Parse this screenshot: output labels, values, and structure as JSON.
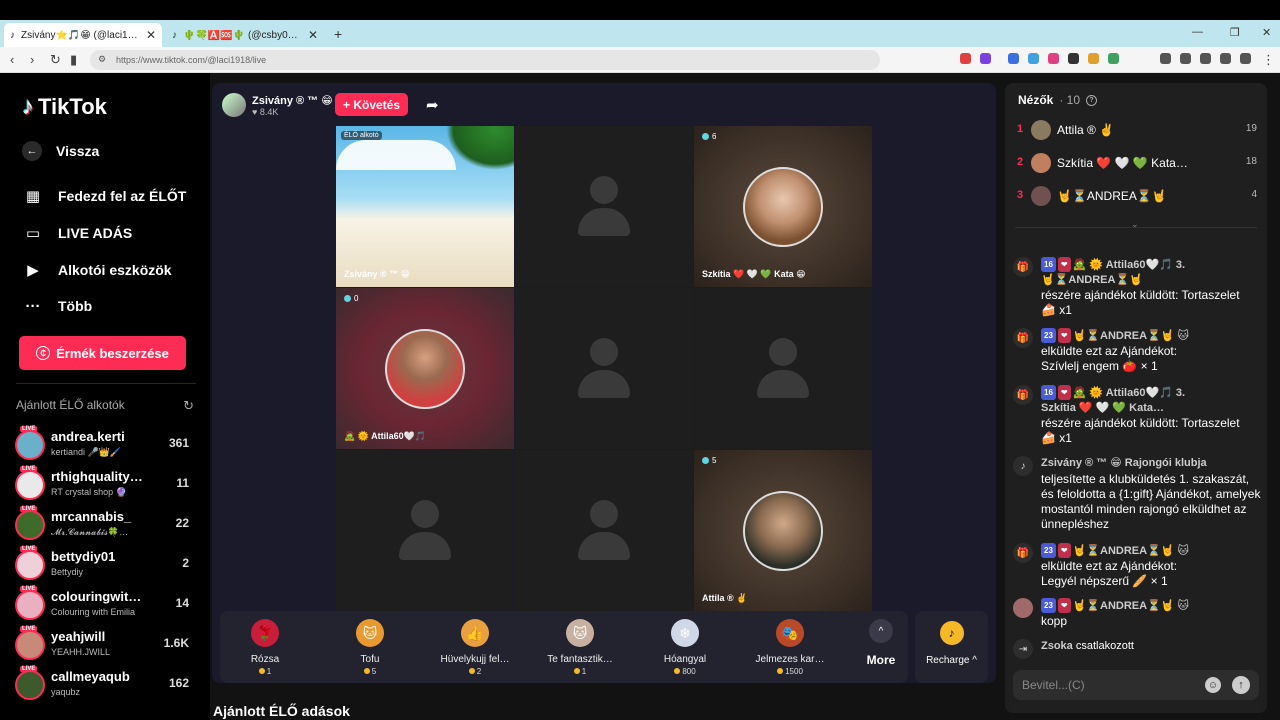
{
  "browser": {
    "tabs": [
      {
        "icon": "tiktok-icon",
        "title": "Zsivány⭐🎵😁 (@laci1918) É…",
        "close": "✕"
      },
      {
        "icon": "tiktok-icon",
        "title": "🌵🍀🅰️🆘🌵 (@csby0…",
        "close": "✕"
      }
    ],
    "new_tab": "+",
    "url": "https://www.tiktok.com/@laci1918/live"
  },
  "sidebar": {
    "logo": "TikTok",
    "nav": [
      {
        "icon": "back-arrow-icon",
        "label": "Vissza"
      },
      {
        "icon": "explore-live-icon",
        "label": "Fedezd fel az ÉLŐT"
      },
      {
        "icon": "video-camera-icon",
        "label": "LIVE ADÁS"
      },
      {
        "icon": "creator-tools-icon",
        "label": "Alkotói eszközök"
      },
      {
        "icon": "more-dots-icon",
        "label": "Több"
      }
    ],
    "coins_button": "Érmék beszerzése",
    "recommended_title": "Ajánlott ÉLŐ alkotók",
    "creators": [
      {
        "name": "andrea.kerti",
        "sub": "kertiandi 🎤👑🖌️",
        "viewers": "361",
        "live": "LIVE",
        "color": "#6bb0c9"
      },
      {
        "name": "rthighquality…",
        "sub": "RT crystal shop 🔮",
        "viewers": "11",
        "live": "LIVE",
        "color": "#e9e9e9"
      },
      {
        "name": "mrcannabis_",
        "sub": "𝓜𝓻.𝓒𝓪𝓷𝓷𝓪𝓫𝓲𝓼🍀…",
        "viewers": "22",
        "live": "LIVE",
        "color": "#3f6b2a"
      },
      {
        "name": "bettydiy01",
        "sub": "Bettydiy",
        "viewers": "2",
        "live": "LIVE",
        "color": "#f0d0d8"
      },
      {
        "name": "colouringwit…",
        "sub": "Colouring with Emilia",
        "viewers": "14",
        "live": "LIVE",
        "color": "#e8b0c0"
      },
      {
        "name": "yeahjwill",
        "sub": "YEAHH.JWILL",
        "viewers": "1.6K",
        "live": "LIVE",
        "color": "#c88a78"
      },
      {
        "name": "callmeyaqub",
        "sub": "yaqubz",
        "viewers": "162",
        "live": "LIVE",
        "color": "#3c5a2c"
      }
    ]
  },
  "stream": {
    "host_name": "Zsivány ® ™ 😁",
    "likes": "♥ 8.4K",
    "follow_button": "+ Követés",
    "cells": [
      {
        "badge": "ÉLŐ alkotó",
        "name": "Zsivány ® ™ 😁"
      },
      {},
      {
        "count": "6",
        "name": "Szkítia ❤️ 🤍 💚 Kata 😁"
      },
      {
        "count": "0",
        "name": "🧟 🌞 Attila60🤍🎵"
      },
      {},
      {},
      {},
      {},
      {
        "count": "5",
        "name": "Attila ® ✌️"
      }
    ],
    "gifts": [
      {
        "name": "Rózsa",
        "price": "1",
        "emoji": "🌹",
        "color": "#c81e3a"
      },
      {
        "name": "Tofu",
        "price": "5",
        "emoji": "🐱",
        "color": "#e89a30"
      },
      {
        "name": "Hüvelykujj fel…",
        "price": "2",
        "emoji": "👍",
        "color": "#e8a040"
      },
      {
        "name": "Te fantasztik…",
        "price": "1",
        "emoji": "🐱",
        "color": "#c8b0a0"
      },
      {
        "name": "Hóangyal",
        "price": "800",
        "emoji": "❄",
        "color": "#d0d8e8"
      },
      {
        "name": "Jelmezes kar…",
        "price": "1500",
        "emoji": "🎭",
        "color": "#b84a2a"
      }
    ],
    "more_label": "More",
    "recharge_label": "Recharge ^",
    "recommended_live": "Ajánlott ÉLŐ adások"
  },
  "chat": {
    "viewers_label": "Nézők",
    "viewers_count": "· 10",
    "top_viewers": [
      {
        "rank": "1",
        "name": "Attila ® ✌️",
        "score": "19",
        "color": "#8a7a60"
      },
      {
        "rank": "2",
        "name": "Szkítia ❤️ 🤍 💚 Kata…",
        "score": "18",
        "color": "#c08060"
      },
      {
        "rank": "3",
        "name": "🤘⏳ANDREA⏳🤘",
        "score": "4",
        "color": "#705050"
      }
    ],
    "messages": [
      {
        "badges": [
          "16",
          "❤"
        ],
        "who": "🧟 🌞 Attila60🤍🎵 3.",
        "who2": "🤘⏳ANDREA⏳🤘",
        "text": "részére ajándékot küldött: Tortaszelet",
        "text2": "🍰 x1",
        "icon": "gift-icon"
      },
      {
        "badges": [
          "23",
          "❤"
        ],
        "who": "🤘⏳ANDREA⏳🤘 🐱",
        "text": "elküldte ezt az Ajándékot:",
        "text2": " Szívlelj engem 🍅 × 1",
        "icon": "gift-icon"
      },
      {
        "badges": [
          "16",
          "❤"
        ],
        "who": "🧟 🌞 Attila60🤍🎵 3.",
        "who2": "Szkítia ❤️ 🤍 💚 Kata…",
        "text": "részére ajándékot küldött: Tortaszelet",
        "text2": "🍰 x1",
        "icon": "gift-icon"
      },
      {
        "who": "Zsivány ® ™ 😁 Rajongói klubja",
        "text": "teljesítette a klubküldetés 1. szakaszát, és feloldotta a {1:gift} Ajándékot, amelyek mostantól minden rajongó elküldhet az ünnepléshez",
        "icon": "tiktok-icon"
      },
      {
        "badges": [
          "23",
          "❤"
        ],
        "who": "🤘⏳ANDREA⏳🤘 🐱",
        "text": "elküldte ezt az Ajándékot:",
        "text2": " Legyél népszerű 🥖 × 1",
        "icon": "gift-icon"
      },
      {
        "badges": [
          "23",
          "❤"
        ],
        "who": "🤘⏳ANDREA⏳🤘 🐱",
        "text": "kopp",
        "icon": "avatar"
      },
      {
        "who": "Zsoka",
        "text": "csatlakozott",
        "icon": "join-icon"
      }
    ],
    "input_placeholder": "Bevitel...(C)"
  }
}
